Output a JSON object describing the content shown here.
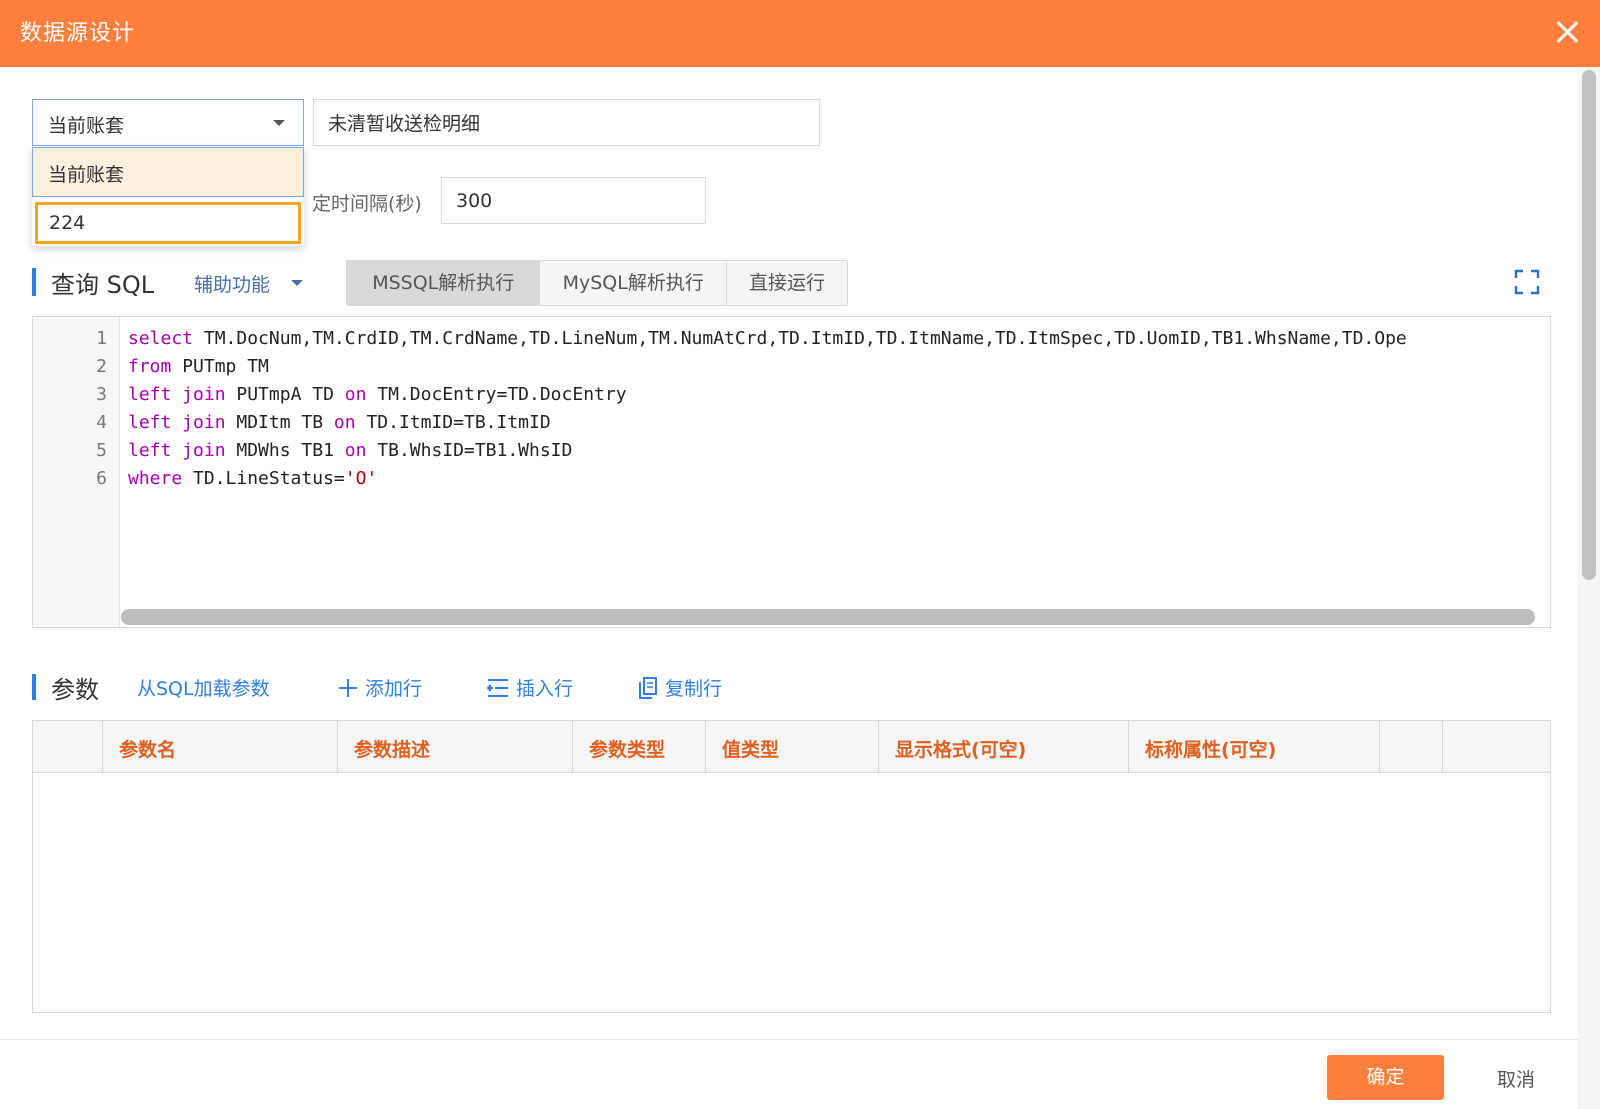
{
  "dialog": {
    "title": "数据源设计"
  },
  "top": {
    "account_select_value": "当前账套",
    "name_input_value": "未清暂收送检明细",
    "dropdown_options": [
      "当前账套",
      "224"
    ],
    "interval_label": "定时间隔(秒)",
    "interval_value": "300"
  },
  "sql": {
    "title": "查询 SQL",
    "assist_label": "辅助功能",
    "buttons": [
      "MSSQL解析执行",
      "MySQL解析执行",
      "直接运行"
    ],
    "active_button": "MSSQL解析执行",
    "line_numbers": [
      "1",
      "2",
      "3",
      "4",
      "5",
      "6"
    ],
    "lines": [
      [
        {
          "t": "select",
          "k": "kw"
        },
        {
          "t": " TM.DocNum,TM.CrdID,TM.CrdName,TD.LineNum,TM.NumAtCrd,TD.ItmID,TD.ItmName,TD.ItmSpec,TD.UomID,TB1.WhsName,TD.Ope",
          "k": ""
        }
      ],
      [
        {
          "t": "from",
          "k": "kw"
        },
        {
          "t": " PUTmp TM",
          "k": ""
        }
      ],
      [
        {
          "t": "left join",
          "k": "kw"
        },
        {
          "t": " PUTmpA TD ",
          "k": ""
        },
        {
          "t": "on",
          "k": "kw"
        },
        {
          "t": " TM.DocEntry=TD.DocEntry",
          "k": ""
        }
      ],
      [
        {
          "t": "left join",
          "k": "kw"
        },
        {
          "t": " MDItm TB ",
          "k": ""
        },
        {
          "t": "on",
          "k": "kw"
        },
        {
          "t": " TD.ItmID=TB.ItmID",
          "k": ""
        }
      ],
      [
        {
          "t": "left join",
          "k": "kw"
        },
        {
          "t": " MDWhs TB1 ",
          "k": ""
        },
        {
          "t": "on",
          "k": "kw"
        },
        {
          "t": " TB.WhsID=TB1.WhsID",
          "k": ""
        }
      ],
      [
        {
          "t": "where",
          "k": "kw"
        },
        {
          "t": " TD.LineStatus=",
          "k": ""
        },
        {
          "t": "'O'",
          "k": "str"
        }
      ]
    ]
  },
  "params": {
    "title": "参数",
    "actions": {
      "load_from_sql": "从SQL加载参数",
      "add_row": "添加行",
      "insert_row": "插入行",
      "copy_row": "复制行"
    },
    "columns": [
      "",
      "参数名",
      "参数描述",
      "参数类型",
      "值类型",
      "显示格式(可空)",
      "标称属性(可空)",
      "",
      ""
    ]
  },
  "footer": {
    "ok_label": "确定",
    "cancel_label": "取消"
  },
  "colors": {
    "accent": "#ff7f3f",
    "link": "#2f7fe0",
    "header_text": "#e06020"
  }
}
